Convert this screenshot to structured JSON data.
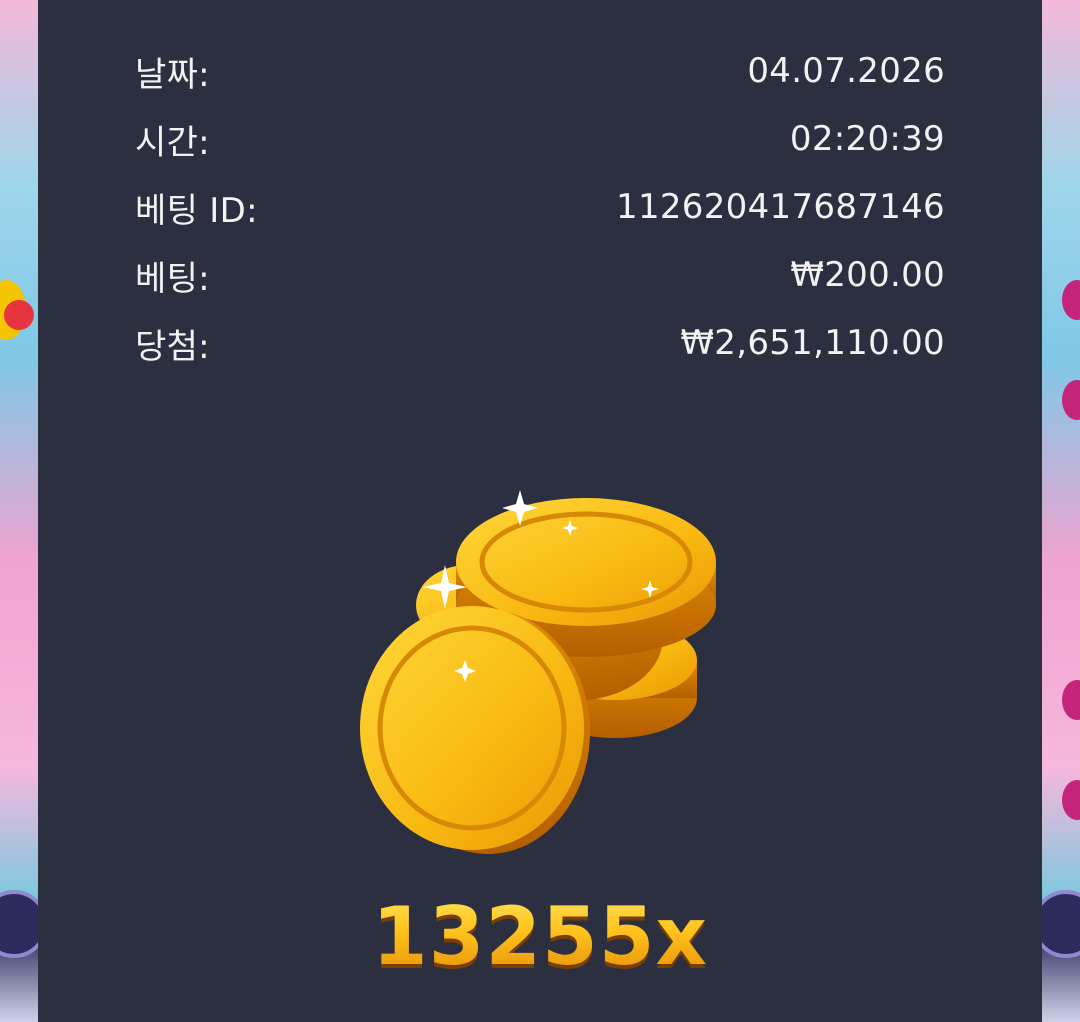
{
  "details": {
    "rows": [
      {
        "label": "날짜:",
        "value": "04.07.2026"
      },
      {
        "label": "시간:",
        "value": "02:20:39"
      },
      {
        "label": "베팅 ID:",
        "value": "112620417687146"
      },
      {
        "label": "베팅:",
        "value": "₩200.00"
      },
      {
        "label": "당첨:",
        "value": "₩2,651,110.00"
      }
    ]
  },
  "result": {
    "icon": "gold-coins-icon",
    "multiplier": "13255x"
  },
  "colors": {
    "panel_bg": "#2b2f40",
    "text": "#f2f2f2",
    "coin_gold": "#f5b80f",
    "multiplier_gold": "#ffc21c"
  }
}
